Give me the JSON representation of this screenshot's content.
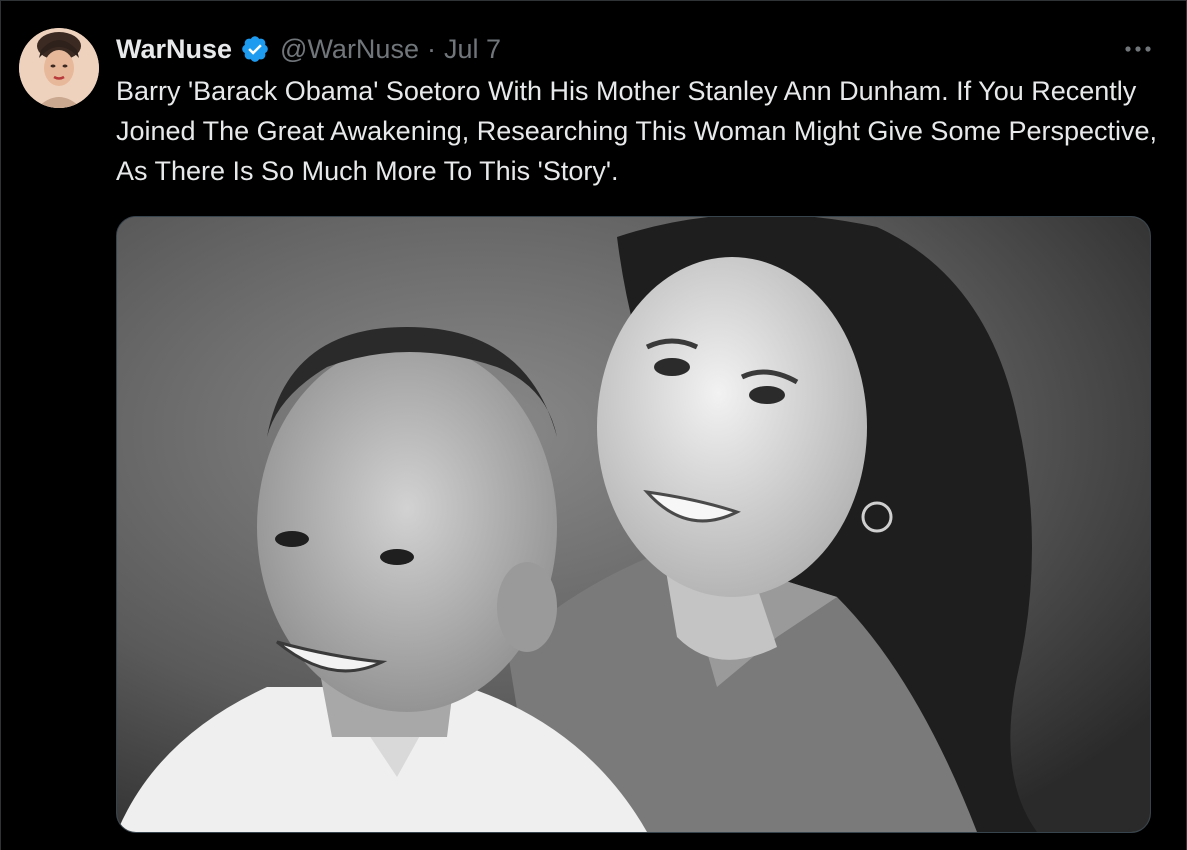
{
  "tweet": {
    "author": {
      "display_name": "WarNuse",
      "handle": "@WarNuse",
      "verified": true,
      "avatar_icon": "profile-avatar"
    },
    "separator": "·",
    "date": "Jul 7",
    "text": "Barry 'Barack Obama' Soetoro With His Mother Stanley Ann Dunham. If You Recently Joined The Great Awakening, Researching This Woman Might Give Some Perspective, As There Is So Much More To This 'Story'.",
    "more_icon": "more-options-icon",
    "media": {
      "type": "black-and-white photo"
    }
  },
  "colors": {
    "background": "#000000",
    "primary_text": "#e7e9ea",
    "secondary_text": "#71767b",
    "verified_badge": "#1d9bf0",
    "border": "#2f3336"
  }
}
